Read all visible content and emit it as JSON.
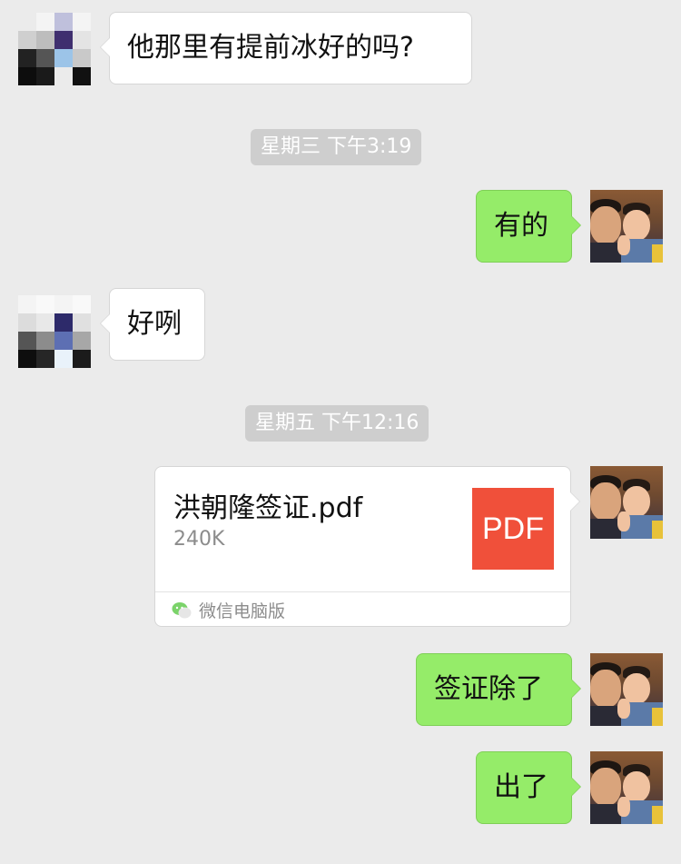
{
  "messages": [
    {
      "text": "他那里有提前冰好的吗?"
    },
    {
      "text": "有的"
    },
    {
      "text": "好咧"
    },
    {
      "text": "签证除了"
    },
    {
      "text": "出了"
    }
  ],
  "timestamps": [
    "星期三 下午3:19",
    "星期五 下午12:16"
  ],
  "file": {
    "name": "洪朝隆签证.pdf",
    "size": "240K",
    "icon_label": "PDF",
    "source": "微信电脑版"
  },
  "colors": {
    "background": "#ebebeb",
    "outgoing_bubble": "#95ec69",
    "incoming_bubble": "#ffffff",
    "timestamp_bg": "#cecece",
    "pdf_icon": "#f0503a"
  }
}
